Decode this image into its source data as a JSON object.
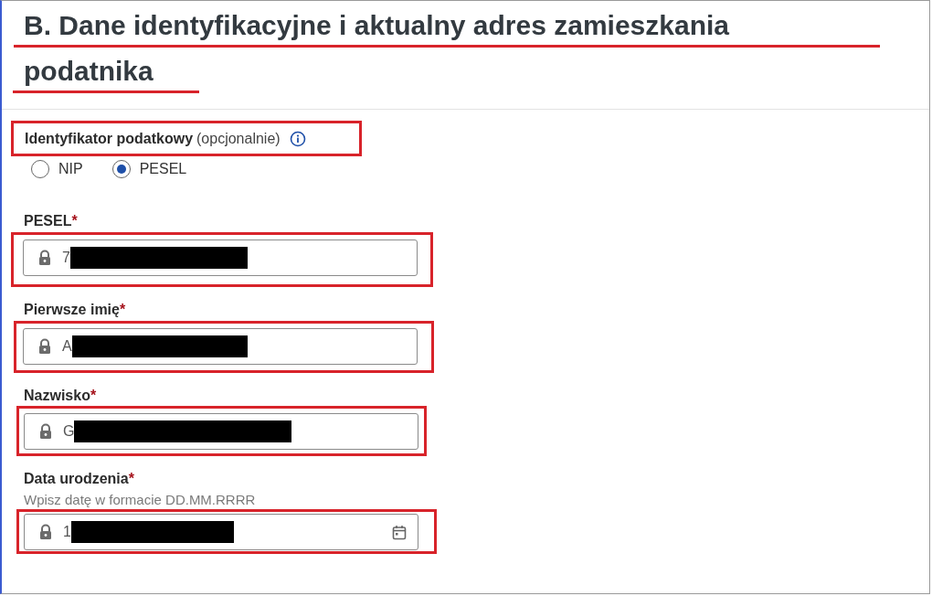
{
  "title_lines": [
    {
      "text": "B. Dane identyfikacyjne i aktualny adres zamieszkania",
      "underlined": true
    },
    {
      "text": "podatnika",
      "underlined": true
    }
  ],
  "tax_id": {
    "label": "Identyfikator podatkowy",
    "note": "(opcjonalnie)",
    "annotated": true,
    "options": [
      {
        "label": "NIP",
        "selected": false
      },
      {
        "label": "PESEL",
        "selected": true
      }
    ]
  },
  "fields": [
    {
      "label": "PESEL",
      "required_mark": "*",
      "value": "7",
      "redacted": true,
      "locked": true,
      "kind": "text",
      "annotated": true
    },
    {
      "label": "Pierwsze imię",
      "required_mark": "*",
      "value": "A",
      "redacted": true,
      "locked": true,
      "kind": "text",
      "annotated": true
    },
    {
      "label": "Nazwisko",
      "required_mark": "*",
      "value": "G",
      "redacted": true,
      "locked": true,
      "kind": "text",
      "annotated": true
    },
    {
      "label": "Data urodzenia",
      "required_mark": "*",
      "hint": "Wpisz datę w formacie DD.MM.RRRR",
      "value": "1",
      "redacted": true,
      "locked": true,
      "kind": "date",
      "annotated": true
    }
  ]
}
